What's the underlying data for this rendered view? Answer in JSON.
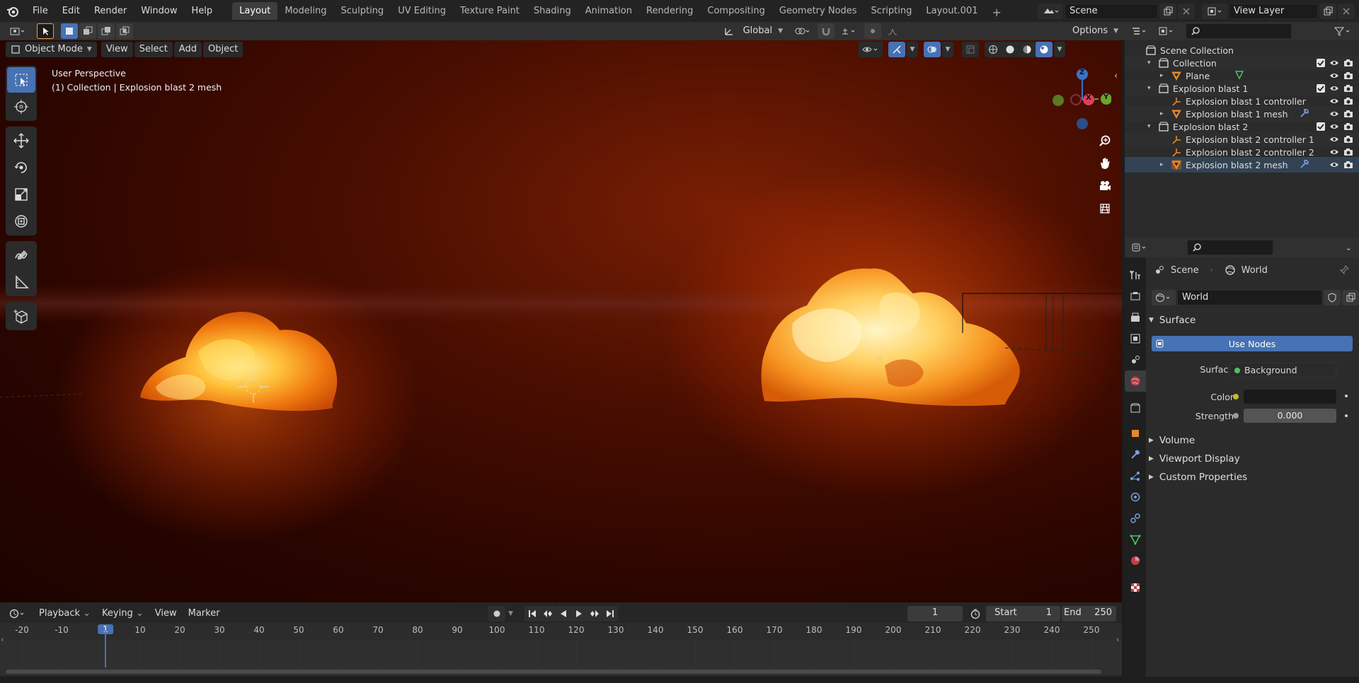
{
  "topbar": {
    "menus": [
      "File",
      "Edit",
      "Render",
      "Window",
      "Help"
    ],
    "workspaces": [
      "Layout",
      "Modeling",
      "Sculpting",
      "UV Editing",
      "Texture Paint",
      "Shading",
      "Animation",
      "Rendering",
      "Compositing",
      "Geometry Nodes",
      "Scripting",
      "Layout.001"
    ],
    "active_workspace": "Layout",
    "scene_name": "Scene",
    "view_layer_name": "View Layer"
  },
  "tool_header": {
    "orientation": "Global",
    "options_label": "Options"
  },
  "viewport": {
    "mode": "Object Mode",
    "menus": [
      "View",
      "Select",
      "Add",
      "Object"
    ],
    "perspective_label": "User Perspective",
    "context_label": "(1) Collection | Explosion blast 2 mesh",
    "gizmo_axes": {
      "z": "Z",
      "x": "X",
      "y": "Y"
    }
  },
  "outliner": {
    "rows": [
      {
        "label": "Scene Collection",
        "indent": 0,
        "icon": "collection-icon",
        "expand": ""
      },
      {
        "label": "Collection",
        "indent": 1,
        "icon": "collection-icon",
        "expand": "▾"
      },
      {
        "label": "Plane",
        "indent": 2,
        "icon": "mesh-icon",
        "expand": "▸"
      },
      {
        "label": "Explosion blast 1",
        "indent": 1,
        "icon": "collection-icon",
        "expand": "▾"
      },
      {
        "label": "Explosion blast 1 controller",
        "indent": 2,
        "icon": "empty-icon",
        "expand": ""
      },
      {
        "label": "Explosion blast 1 mesh",
        "indent": 2,
        "icon": "mesh-icon",
        "expand": "▸"
      },
      {
        "label": "Explosion blast 2",
        "indent": 1,
        "icon": "collection-icon",
        "expand": "▾"
      },
      {
        "label": "Explosion blast 2 controller 1",
        "indent": 2,
        "icon": "empty-icon",
        "expand": ""
      },
      {
        "label": "Explosion blast 2 controller 2",
        "indent": 2,
        "icon": "empty-icon",
        "expand": ""
      },
      {
        "label": "Explosion blast 2 mesh",
        "indent": 2,
        "icon": "mesh-icon",
        "expand": "▸"
      }
    ]
  },
  "properties": {
    "breadcrumb_scene": "Scene",
    "breadcrumb_world": "World",
    "world_name": "World",
    "surface_panel": "Surface",
    "use_nodes_label": "Use Nodes",
    "surface_label": "Surface",
    "surface_value": "Background",
    "color_label": "Color",
    "strength_label": "Strength",
    "strength_value": "0.000",
    "collapsed_panels": [
      "Volume",
      "Viewport Display",
      "Custom Properties"
    ]
  },
  "timeline": {
    "menus": [
      "Playback",
      "Keying",
      "View",
      "Marker"
    ],
    "current_frame": "1",
    "start_label": "Start",
    "start_value": "1",
    "end_label": "End",
    "end_value": "250",
    "ruler_ticks": [
      "-20",
      "-10",
      "1",
      "10",
      "20",
      "30",
      "40",
      "50",
      "60",
      "70",
      "80",
      "90",
      "100",
      "110",
      "120",
      "130",
      "140",
      "150",
      "160",
      "170",
      "180",
      "190",
      "200",
      "210",
      "220",
      "230",
      "240",
      "250"
    ]
  }
}
